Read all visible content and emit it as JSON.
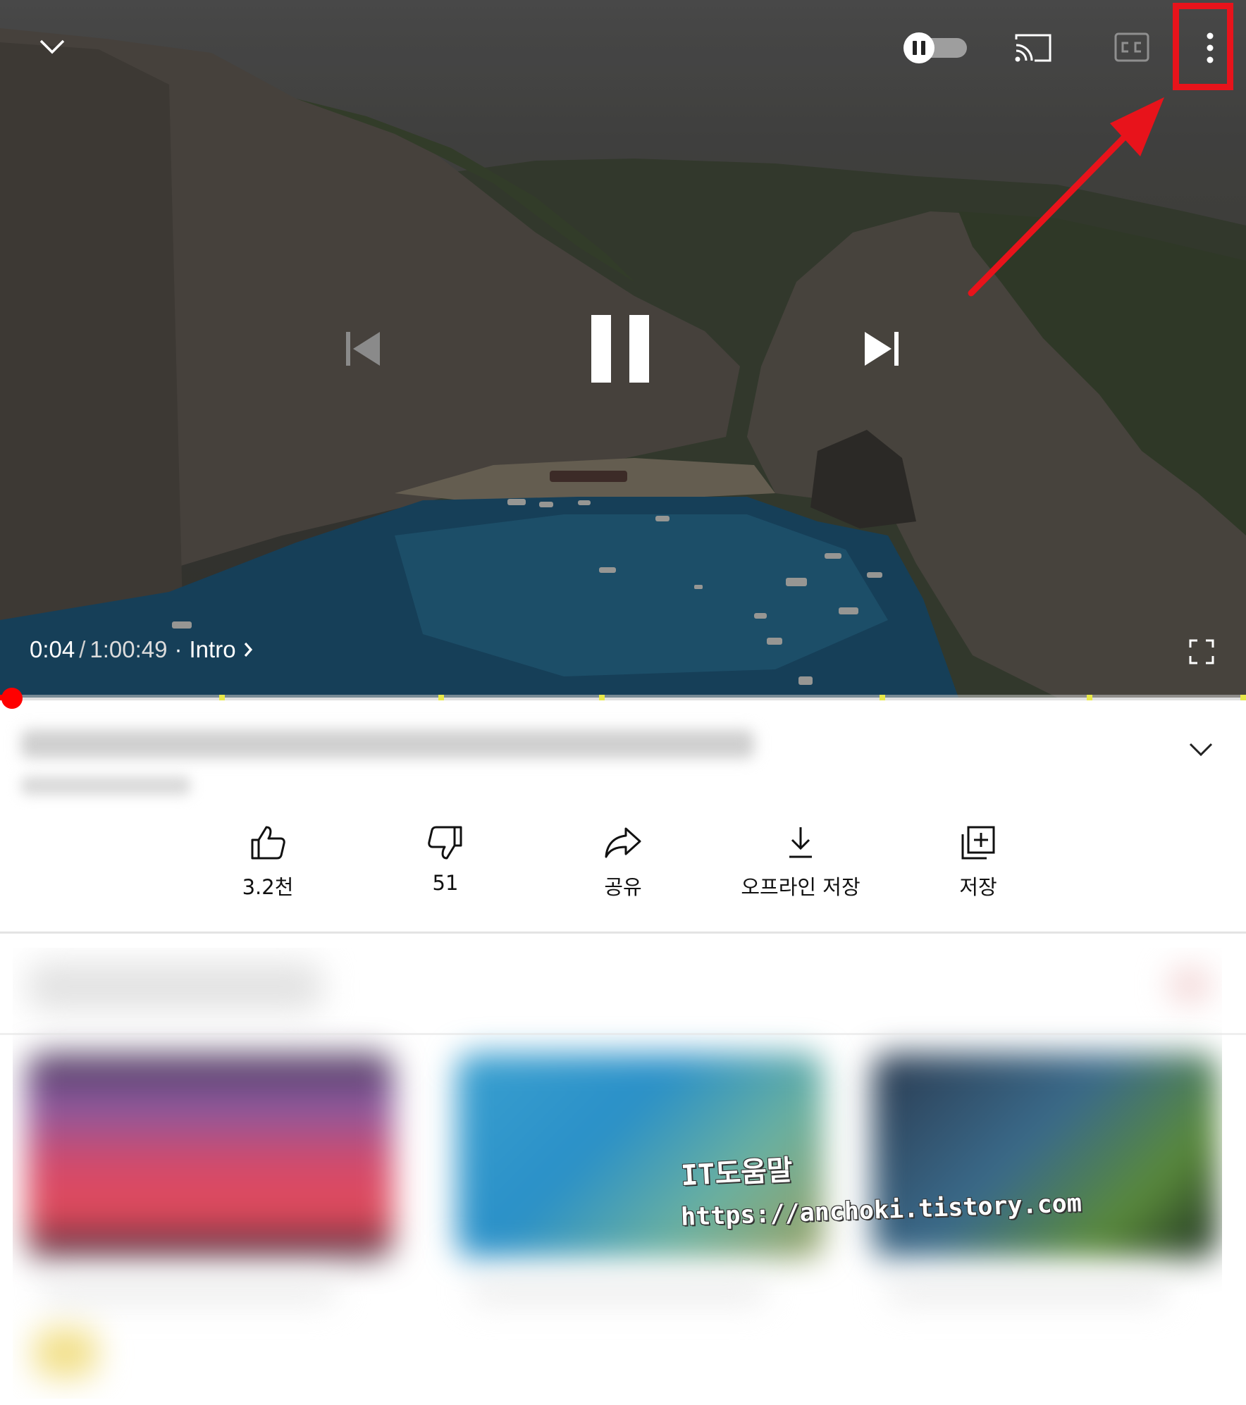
{
  "player": {
    "current_time": "0:04",
    "separator": "/",
    "duration": "1:00:49",
    "chapter_dot": "·",
    "chapter": "Intro",
    "progress_fraction": 0.005,
    "chapter_marker_fractions": [
      0.176,
      0.352,
      0.481,
      0.706,
      0.872,
      0.998
    ],
    "autoplay_state": "paused",
    "icons": {
      "collapse": "chevron-down-icon",
      "autoplay": "autoplay-toggle-icon",
      "cast": "cast-icon",
      "captions": "cc-icon",
      "more": "more-vertical-icon",
      "previous": "skip-previous-icon",
      "play_pause": "pause-icon",
      "next": "skip-next-icon",
      "fullscreen": "fullscreen-icon",
      "chapter_chevron": "chevron-right-icon"
    }
  },
  "annotation": {
    "color": "#e8131b",
    "target": "more-vertical-icon"
  },
  "actions": [
    {
      "name": "like",
      "label": "3.2천",
      "icon": "thumbs-up-icon"
    },
    {
      "name": "dislike",
      "label": "51",
      "icon": "thumbs-down-icon"
    },
    {
      "name": "share",
      "label": "공유",
      "icon": "share-icon"
    },
    {
      "name": "download",
      "label": "오프라인 저장",
      "icon": "download-icon"
    },
    {
      "name": "save",
      "label": "저장",
      "icon": "save-to-playlist-icon"
    }
  ],
  "watermark": {
    "line1": "IT도움말",
    "line2": "https://anchoki.tistory.com"
  },
  "colors": {
    "accent_red": "#ff0000",
    "chapter_marker": "#e8e84a",
    "annotation_red": "#e8131b"
  }
}
